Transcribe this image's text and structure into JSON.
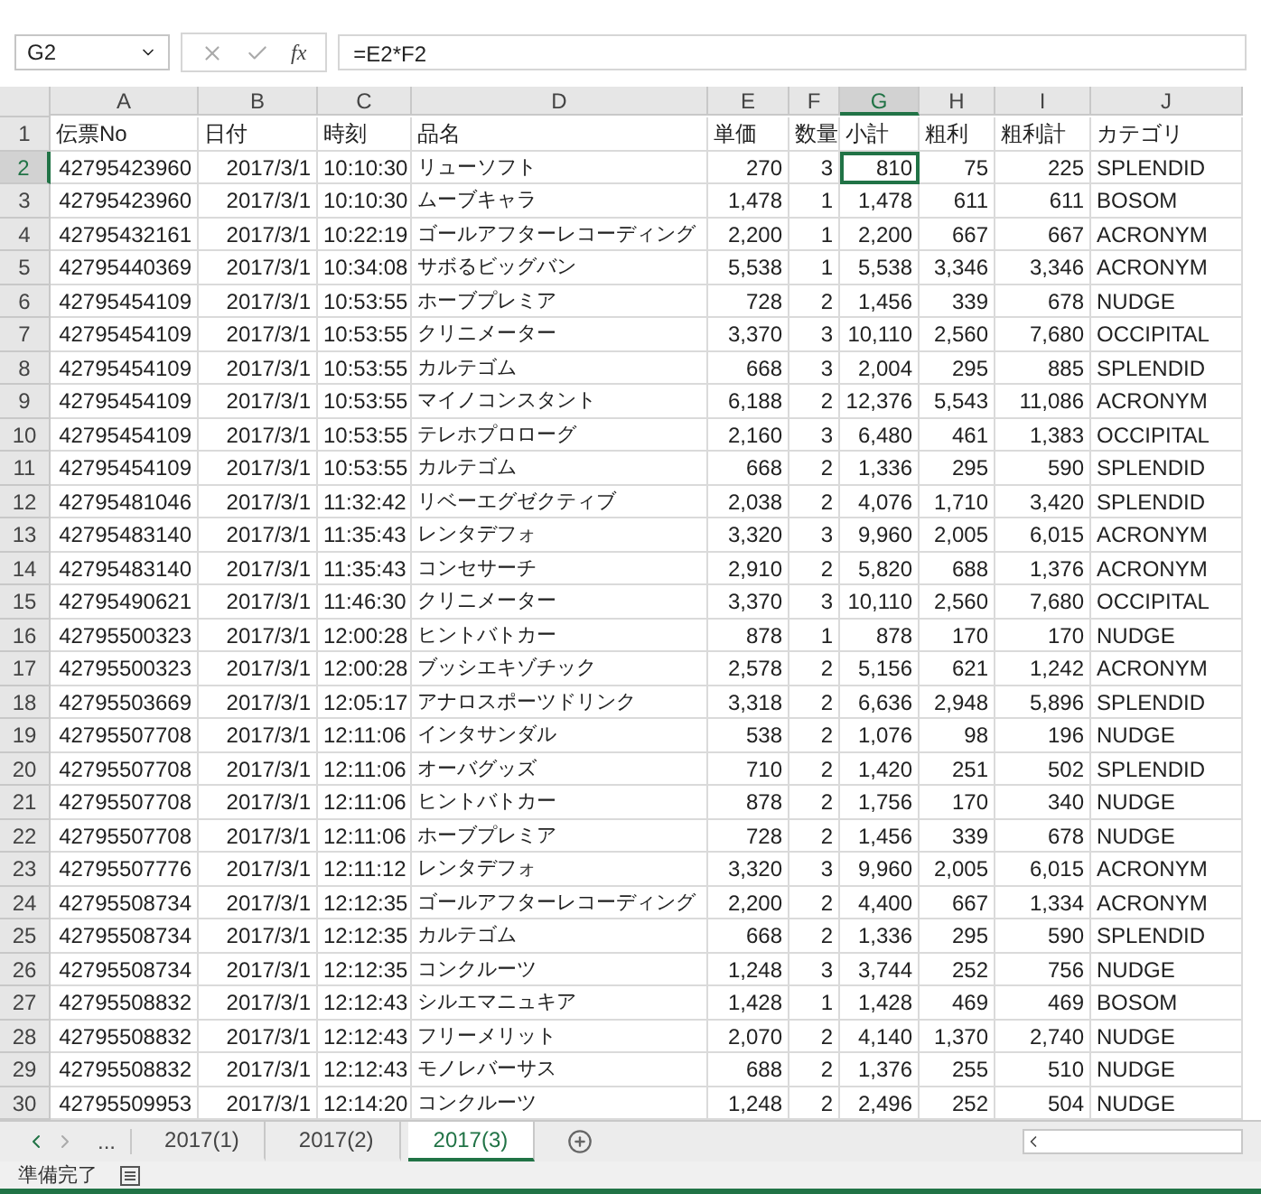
{
  "formula_bar": {
    "name_box": "G2",
    "function_label": "fx",
    "formula": "=E2*F2"
  },
  "columns": [
    {
      "letter": "A",
      "selected": false
    },
    {
      "letter": "B",
      "selected": false
    },
    {
      "letter": "C",
      "selected": false
    },
    {
      "letter": "D",
      "selected": false
    },
    {
      "letter": "E",
      "selected": false
    },
    {
      "letter": "F",
      "selected": false
    },
    {
      "letter": "G",
      "selected": true
    },
    {
      "letter": "H",
      "selected": false
    },
    {
      "letter": "I",
      "selected": false
    },
    {
      "letter": "J",
      "selected": false
    }
  ],
  "rows": [
    {
      "number": "1",
      "selected": false,
      "kind": "header",
      "cells": [
        "伝票No",
        "日付",
        "時刻",
        "品名",
        "単価",
        "数量",
        "小計",
        "粗利",
        "粗利計",
        "カテゴリ"
      ]
    },
    {
      "number": "2",
      "selected": true,
      "kind": "data",
      "cells": [
        "42795423960",
        "2017/3/1",
        "10:10:30",
        "リューソフト",
        "270",
        "3",
        "810",
        "75",
        "225",
        "SPLENDID"
      ]
    },
    {
      "number": "3",
      "selected": false,
      "kind": "data",
      "cells": [
        "42795423960",
        "2017/3/1",
        "10:10:30",
        "ムーブキャラ",
        "1,478",
        "1",
        "1,478",
        "611",
        "611",
        "BOSOM"
      ]
    },
    {
      "number": "4",
      "selected": false,
      "kind": "data",
      "cells": [
        "42795432161",
        "2017/3/1",
        "10:22:19",
        "ゴールアフターレコーディング",
        "2,200",
        "1",
        "2,200",
        "667",
        "667",
        "ACRONYM"
      ]
    },
    {
      "number": "5",
      "selected": false,
      "kind": "data",
      "cells": [
        "42795440369",
        "2017/3/1",
        "10:34:08",
        "サボるビッグバン",
        "5,538",
        "1",
        "5,538",
        "3,346",
        "3,346",
        "ACRONYM"
      ]
    },
    {
      "number": "6",
      "selected": false,
      "kind": "data",
      "cells": [
        "42795454109",
        "2017/3/1",
        "10:53:55",
        "ホーブプレミア",
        "728",
        "2",
        "1,456",
        "339",
        "678",
        "NUDGE"
      ]
    },
    {
      "number": "7",
      "selected": false,
      "kind": "data",
      "cells": [
        "42795454109",
        "2017/3/1",
        "10:53:55",
        "クリニメーター",
        "3,370",
        "3",
        "10,110",
        "2,560",
        "7,680",
        "OCCIPITAL"
      ]
    },
    {
      "number": "8",
      "selected": false,
      "kind": "data",
      "cells": [
        "42795454109",
        "2017/3/1",
        "10:53:55",
        "カルテゴム",
        "668",
        "3",
        "2,004",
        "295",
        "885",
        "SPLENDID"
      ]
    },
    {
      "number": "9",
      "selected": false,
      "kind": "data",
      "cells": [
        "42795454109",
        "2017/3/1",
        "10:53:55",
        "マイノコンスタント",
        "6,188",
        "2",
        "12,376",
        "5,543",
        "11,086",
        "ACRONYM"
      ]
    },
    {
      "number": "10",
      "selected": false,
      "kind": "data",
      "cells": [
        "42795454109",
        "2017/3/1",
        "10:53:55",
        "テレホプロローグ",
        "2,160",
        "3",
        "6,480",
        "461",
        "1,383",
        "OCCIPITAL"
      ]
    },
    {
      "number": "11",
      "selected": false,
      "kind": "data",
      "cells": [
        "42795454109",
        "2017/3/1",
        "10:53:55",
        "カルテゴム",
        "668",
        "2",
        "1,336",
        "295",
        "590",
        "SPLENDID"
      ]
    },
    {
      "number": "12",
      "selected": false,
      "kind": "data",
      "cells": [
        "42795481046",
        "2017/3/1",
        "11:32:42",
        "リベーエグゼクティブ",
        "2,038",
        "2",
        "4,076",
        "1,710",
        "3,420",
        "SPLENDID"
      ]
    },
    {
      "number": "13",
      "selected": false,
      "kind": "data",
      "cells": [
        "42795483140",
        "2017/3/1",
        "11:35:43",
        "レンタデフォ",
        "3,320",
        "3",
        "9,960",
        "2,005",
        "6,015",
        "ACRONYM"
      ]
    },
    {
      "number": "14",
      "selected": false,
      "kind": "data",
      "cells": [
        "42795483140",
        "2017/3/1",
        "11:35:43",
        "コンセサーチ",
        "2,910",
        "2",
        "5,820",
        "688",
        "1,376",
        "ACRONYM"
      ]
    },
    {
      "number": "15",
      "selected": false,
      "kind": "data",
      "cells": [
        "42795490621",
        "2017/3/1",
        "11:46:30",
        "クリニメーター",
        "3,370",
        "3",
        "10,110",
        "2,560",
        "7,680",
        "OCCIPITAL"
      ]
    },
    {
      "number": "16",
      "selected": false,
      "kind": "data",
      "cells": [
        "42795500323",
        "2017/3/1",
        "12:00:28",
        "ヒントバトカー",
        "878",
        "1",
        "878",
        "170",
        "170",
        "NUDGE"
      ]
    },
    {
      "number": "17",
      "selected": false,
      "kind": "data",
      "cells": [
        "42795500323",
        "2017/3/1",
        "12:00:28",
        "ブッシエキゾチック",
        "2,578",
        "2",
        "5,156",
        "621",
        "1,242",
        "ACRONYM"
      ]
    },
    {
      "number": "18",
      "selected": false,
      "kind": "data",
      "cells": [
        "42795503669",
        "2017/3/1",
        "12:05:17",
        "アナロスポーツドリンク",
        "3,318",
        "2",
        "6,636",
        "2,948",
        "5,896",
        "SPLENDID"
      ]
    },
    {
      "number": "19",
      "selected": false,
      "kind": "data",
      "cells": [
        "42795507708",
        "2017/3/1",
        "12:11:06",
        "インタサンダル",
        "538",
        "2",
        "1,076",
        "98",
        "196",
        "NUDGE"
      ]
    },
    {
      "number": "20",
      "selected": false,
      "kind": "data",
      "cells": [
        "42795507708",
        "2017/3/1",
        "12:11:06",
        "オーバグッズ",
        "710",
        "2",
        "1,420",
        "251",
        "502",
        "SPLENDID"
      ]
    },
    {
      "number": "21",
      "selected": false,
      "kind": "data",
      "cells": [
        "42795507708",
        "2017/3/1",
        "12:11:06",
        "ヒントバトカー",
        "878",
        "2",
        "1,756",
        "170",
        "340",
        "NUDGE"
      ]
    },
    {
      "number": "22",
      "selected": false,
      "kind": "data",
      "cells": [
        "42795507708",
        "2017/3/1",
        "12:11:06",
        "ホーブプレミア",
        "728",
        "2",
        "1,456",
        "339",
        "678",
        "NUDGE"
      ]
    },
    {
      "number": "23",
      "selected": false,
      "kind": "data",
      "cells": [
        "42795507776",
        "2017/3/1",
        "12:11:12",
        "レンタデフォ",
        "3,320",
        "3",
        "9,960",
        "2,005",
        "6,015",
        "ACRONYM"
      ]
    },
    {
      "number": "24",
      "selected": false,
      "kind": "data",
      "cells": [
        "42795508734",
        "2017/3/1",
        "12:12:35",
        "ゴールアフターレコーディング",
        "2,200",
        "2",
        "4,400",
        "667",
        "1,334",
        "ACRONYM"
      ]
    },
    {
      "number": "25",
      "selected": false,
      "kind": "data",
      "cells": [
        "42795508734",
        "2017/3/1",
        "12:12:35",
        "カルテゴム",
        "668",
        "2",
        "1,336",
        "295",
        "590",
        "SPLENDID"
      ]
    },
    {
      "number": "26",
      "selected": false,
      "kind": "data",
      "cells": [
        "42795508734",
        "2017/3/1",
        "12:12:35",
        "コンクルーツ",
        "1,248",
        "3",
        "3,744",
        "252",
        "756",
        "NUDGE"
      ]
    },
    {
      "number": "27",
      "selected": false,
      "kind": "data",
      "cells": [
        "42795508832",
        "2017/3/1",
        "12:12:43",
        "シルエマニュキア",
        "1,428",
        "1",
        "1,428",
        "469",
        "469",
        "BOSOM"
      ]
    },
    {
      "number": "28",
      "selected": false,
      "kind": "data",
      "cells": [
        "42795508832",
        "2017/3/1",
        "12:12:43",
        "フリーメリット",
        "2,070",
        "2",
        "4,140",
        "1,370",
        "2,740",
        "NUDGE"
      ]
    },
    {
      "number": "29",
      "selected": false,
      "kind": "data",
      "cells": [
        "42795508832",
        "2017/3/1",
        "12:12:43",
        "モノレバーサス",
        "688",
        "2",
        "1,376",
        "255",
        "510",
        "NUDGE"
      ]
    },
    {
      "number": "30",
      "selected": false,
      "kind": "data",
      "cells": [
        "42795509953",
        "2017/3/1",
        "12:14:20",
        "コンクルーツ",
        "1,248",
        "2",
        "2,496",
        "252",
        "504",
        "NUDGE"
      ]
    }
  ],
  "sheet_tabs": {
    "overflow": "...",
    "tabs": [
      {
        "label": "2017(1)",
        "selected": false
      },
      {
        "label": "2017(2)",
        "selected": false
      },
      {
        "label": "2017(3)",
        "selected": true
      }
    ]
  },
  "status_bar": {
    "text": "準備完了"
  }
}
